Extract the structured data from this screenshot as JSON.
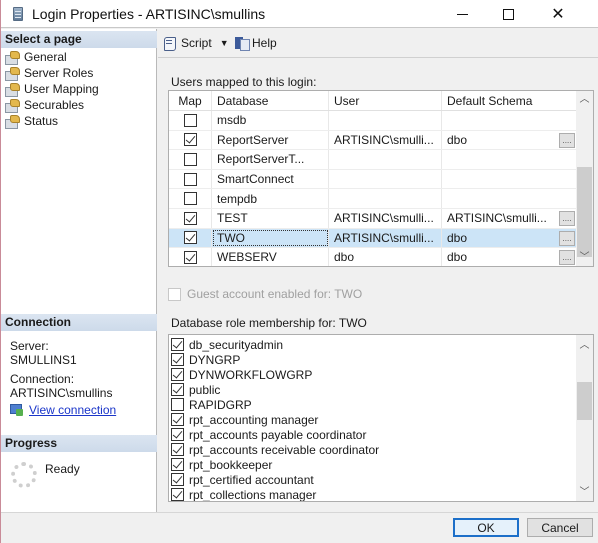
{
  "window": {
    "title": "Login Properties - ARTISINC\\smullins",
    "controls": {
      "minimize": "minimize",
      "maximize": "maximize",
      "close": "close"
    }
  },
  "left_pane": {
    "select_page_header": "Select a page",
    "pages": [
      {
        "label": "General",
        "icon": "page-icon",
        "selected": false
      },
      {
        "label": "Server Roles",
        "icon": "page-icon",
        "selected": false
      },
      {
        "label": "User Mapping",
        "icon": "page-icon",
        "selected": true
      },
      {
        "label": "Securables",
        "icon": "page-icon",
        "selected": false
      },
      {
        "label": "Status",
        "icon": "page-icon",
        "selected": false
      }
    ],
    "connection_header": "Connection",
    "server_label": "Server:",
    "server_value": "SMULLINS1",
    "connection_label": "Connection:",
    "connection_value": "ARTISINC\\smullins",
    "view_connection_link": "View connection",
    "progress_header": "Progress",
    "progress_status": "Ready"
  },
  "toolbar": {
    "script_label": "Script",
    "help_label": "Help"
  },
  "users_mapped": {
    "label": "Users mapped to this login:",
    "columns": [
      "Map",
      "Database",
      "User",
      "Default Schema"
    ],
    "rows": [
      {
        "map": false,
        "database": "msdb",
        "user": "",
        "schema": "",
        "has_button": false,
        "selected": false
      },
      {
        "map": true,
        "database": "ReportServer",
        "user": "ARTISINC\\smulli...",
        "schema": "dbo",
        "has_button": true,
        "selected": false
      },
      {
        "map": false,
        "database": "ReportServerT...",
        "user": "",
        "schema": "",
        "has_button": false,
        "selected": false
      },
      {
        "map": false,
        "database": "SmartConnect",
        "user": "",
        "schema": "",
        "has_button": false,
        "selected": false
      },
      {
        "map": false,
        "database": "tempdb",
        "user": "",
        "schema": "",
        "has_button": false,
        "selected": false
      },
      {
        "map": true,
        "database": "TEST",
        "user": "ARTISINC\\smulli...",
        "schema": "ARTISINC\\smulli...",
        "has_button": true,
        "selected": false
      },
      {
        "map": true,
        "database": "TWO",
        "user": "ARTISINC\\smulli...",
        "schema": "dbo",
        "has_button": true,
        "selected": true
      },
      {
        "map": true,
        "database": "WEBSERV",
        "user": "dbo",
        "schema": "dbo",
        "has_button": true,
        "selected": false
      }
    ],
    "ellipsis_label": "....",
    "scroll_up": "^",
    "scroll_down": "v"
  },
  "guest": {
    "label": "Guest account enabled for: TWO",
    "checked": false,
    "enabled": false
  },
  "roles": {
    "label": "Database role membership for: TWO",
    "items": [
      {
        "name": "db_securityadmin",
        "checked": true
      },
      {
        "name": "DYNGRP",
        "checked": true
      },
      {
        "name": "DYNWORKFLOWGRP",
        "checked": true
      },
      {
        "name": "public",
        "checked": true
      },
      {
        "name": "RAPIDGRP",
        "checked": false
      },
      {
        "name": "rpt_accounting manager",
        "checked": true
      },
      {
        "name": "rpt_accounts payable coordinator",
        "checked": true
      },
      {
        "name": "rpt_accounts receivable coordinator",
        "checked": true
      },
      {
        "name": "rpt_bookkeeper",
        "checked": true
      },
      {
        "name": "rpt_certified accountant",
        "checked": true
      },
      {
        "name": "rpt_collections manager",
        "checked": true
      }
    ]
  },
  "buttons": {
    "ok": "OK",
    "cancel": "Cancel"
  },
  "colors": {
    "selected_row": "#cce4f7",
    "section_header": "#d4e0ee",
    "link": "#1a35c9",
    "default_button_border": "#1c6fc9"
  }
}
